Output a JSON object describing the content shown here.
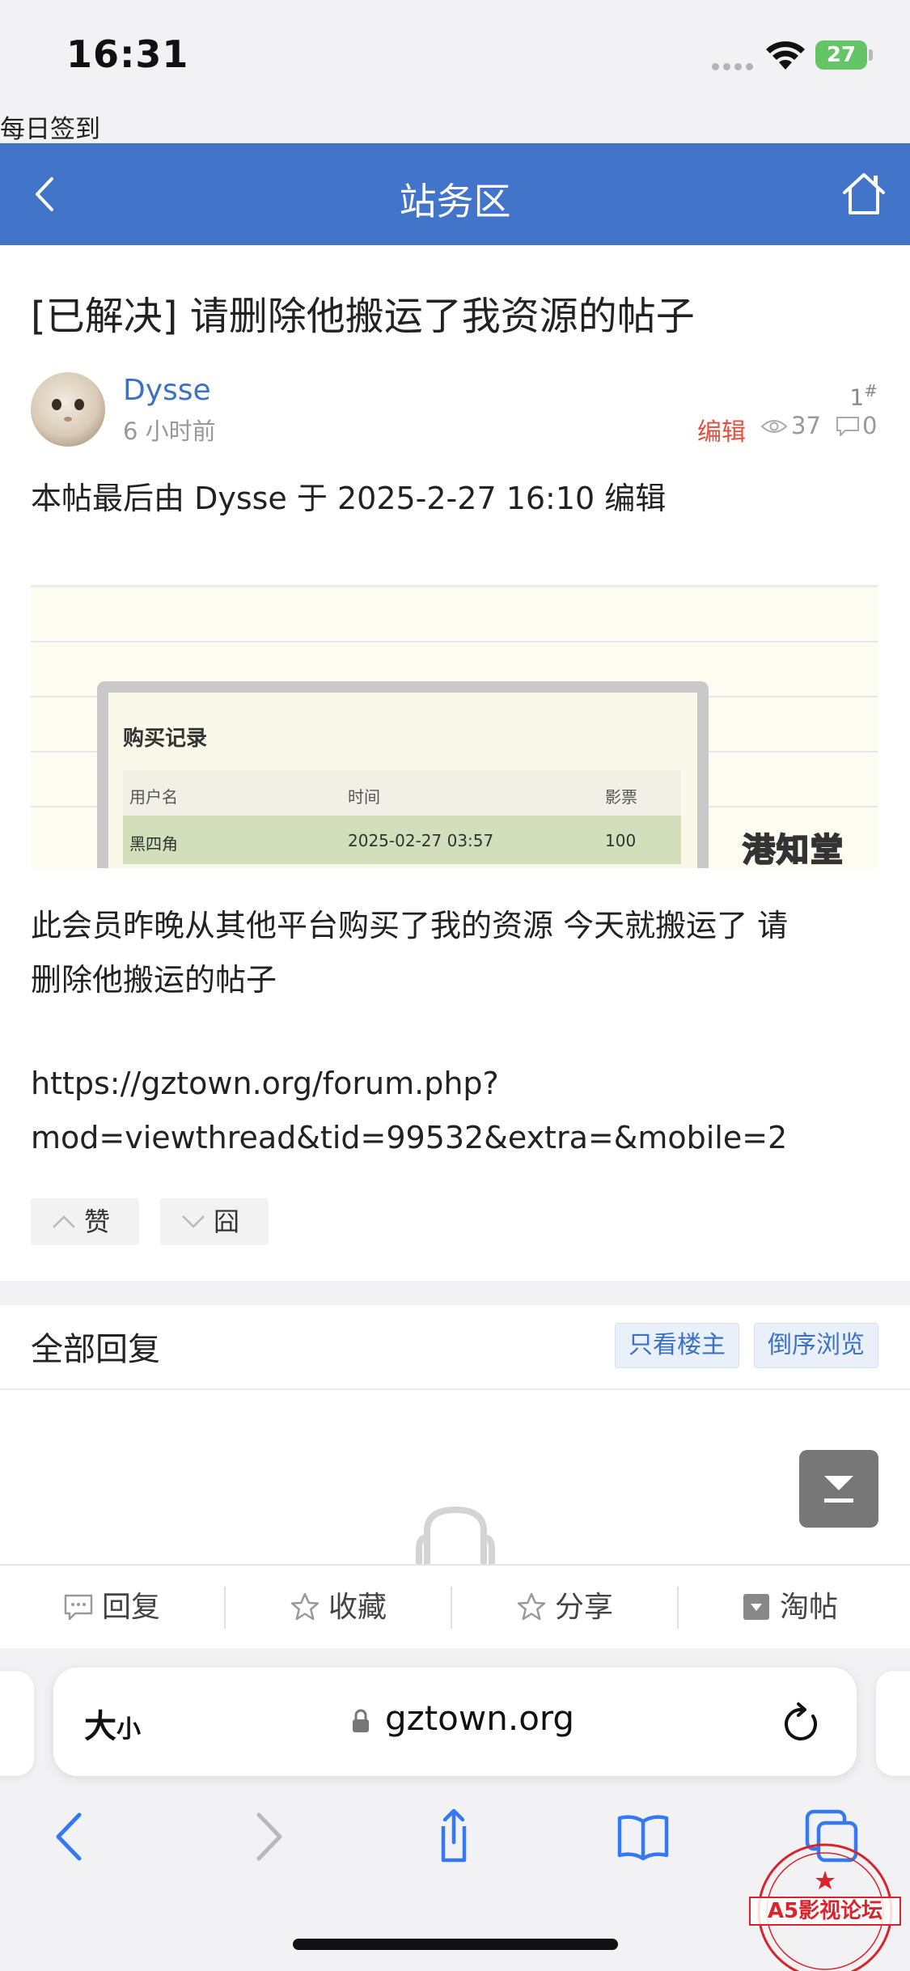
{
  "status_bar": {
    "time": "16:31",
    "battery": "27"
  },
  "page": {
    "sign_in_label": "每日签到"
  },
  "header": {
    "title": "站务区",
    "accent": "#4274c9"
  },
  "post": {
    "title": "[已解决] 请删除他搬运了我资源的帖子",
    "author": "Dysse",
    "time": "6 小时前",
    "floor": "1",
    "floor_mark": "#",
    "edit_label": "编辑",
    "views": "37",
    "comments": "0",
    "edit_note": "本帖最后由 Dysse 于 2025-2-27 16:10 编辑",
    "image": {
      "heading": "购买记录",
      "columns": [
        "用户名",
        "时间",
        "影票"
      ],
      "row": [
        "黑四角",
        "2025-02-27 03:57",
        "100"
      ],
      "watermark": "港知堂"
    },
    "body_line1": "此会员昨晚从其他平台购买了我的资源 今天就搬运了  请",
    "body_line2": "删除他搬运的帖子",
    "link_line1": "https://gztown.org/forum.php?",
    "link_line2": "mod=viewthread&tid=99532&extra=&mobile=2",
    "like_label": "赞",
    "dislike_label": "囧"
  },
  "replies": {
    "title": "全部回复",
    "only_op": "只看楼主",
    "reverse": "倒序浏览"
  },
  "action_bar": {
    "reply": "回复",
    "favorite": "收藏",
    "share": "分享",
    "tao": "淘帖"
  },
  "browser": {
    "text_size_big": "大",
    "text_size_small": "小",
    "url": "gztown.org"
  },
  "stamp": {
    "text": "A5影视论坛"
  }
}
